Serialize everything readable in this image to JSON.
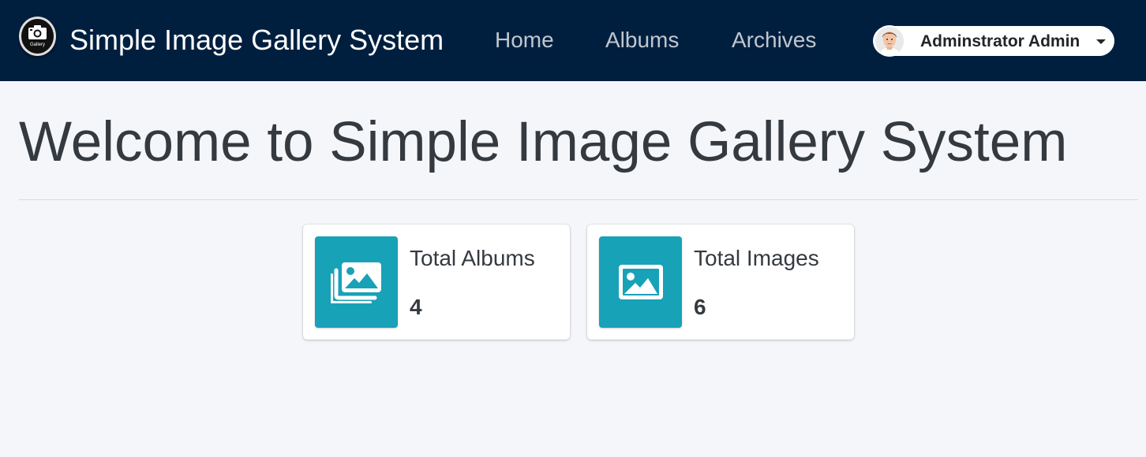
{
  "navbar": {
    "logo": {
      "icon": "camera-icon",
      "text": "Gallery"
    },
    "brand": "Simple Image Gallery System",
    "links": [
      {
        "label": "Home"
      },
      {
        "label": "Albums"
      },
      {
        "label": "Archives"
      }
    ],
    "user": {
      "name": "Adminstrator Admin",
      "avatar_icon": "user-avatar"
    }
  },
  "main": {
    "title": "Welcome to Simple Image Gallery System",
    "stats": [
      {
        "label": "Total Albums",
        "value": "4",
        "icon": "images-icon"
      },
      {
        "label": "Total Images",
        "value": "6",
        "icon": "image-icon"
      }
    ]
  },
  "colors": {
    "navbar_bg": "#001f3f",
    "page_bg": "#f4f6f9",
    "info_icon_bg": "#17a2b8",
    "text": "#343a40"
  }
}
